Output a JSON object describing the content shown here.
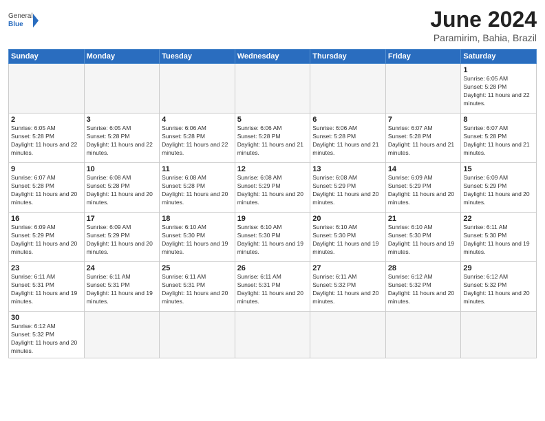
{
  "header": {
    "logo_general": "General",
    "logo_blue": "Blue",
    "month_title": "June 2024",
    "location": "Paramirim, Bahia, Brazil"
  },
  "days": [
    "Sunday",
    "Monday",
    "Tuesday",
    "Wednesday",
    "Thursday",
    "Friday",
    "Saturday"
  ],
  "cells": [
    {
      "date": "",
      "empty": true
    },
    {
      "date": "",
      "empty": true
    },
    {
      "date": "",
      "empty": true
    },
    {
      "date": "",
      "empty": true
    },
    {
      "date": "",
      "empty": true
    },
    {
      "date": "",
      "empty": true
    },
    {
      "date": "1",
      "sunrise": "6:05 AM",
      "sunset": "5:28 PM",
      "daylight": "11 hours and 22 minutes."
    },
    {
      "date": "2",
      "sunrise": "6:05 AM",
      "sunset": "5:28 PM",
      "daylight": "11 hours and 22 minutes."
    },
    {
      "date": "3",
      "sunrise": "6:05 AM",
      "sunset": "5:28 PM",
      "daylight": "11 hours and 22 minutes."
    },
    {
      "date": "4",
      "sunrise": "6:06 AM",
      "sunset": "5:28 PM",
      "daylight": "11 hours and 22 minutes."
    },
    {
      "date": "5",
      "sunrise": "6:06 AM",
      "sunset": "5:28 PM",
      "daylight": "11 hours and 21 minutes."
    },
    {
      "date": "6",
      "sunrise": "6:06 AM",
      "sunset": "5:28 PM",
      "daylight": "11 hours and 21 minutes."
    },
    {
      "date": "7",
      "sunrise": "6:07 AM",
      "sunset": "5:28 PM",
      "daylight": "11 hours and 21 minutes."
    },
    {
      "date": "8",
      "sunrise": "6:07 AM",
      "sunset": "5:28 PM",
      "daylight": "11 hours and 21 minutes."
    },
    {
      "date": "9",
      "sunrise": "6:07 AM",
      "sunset": "5:28 PM",
      "daylight": "11 hours and 20 minutes."
    },
    {
      "date": "10",
      "sunrise": "6:08 AM",
      "sunset": "5:28 PM",
      "daylight": "11 hours and 20 minutes."
    },
    {
      "date": "11",
      "sunrise": "6:08 AM",
      "sunset": "5:28 PM",
      "daylight": "11 hours and 20 minutes."
    },
    {
      "date": "12",
      "sunrise": "6:08 AM",
      "sunset": "5:29 PM",
      "daylight": "11 hours and 20 minutes."
    },
    {
      "date": "13",
      "sunrise": "6:08 AM",
      "sunset": "5:29 PM",
      "daylight": "11 hours and 20 minutes."
    },
    {
      "date": "14",
      "sunrise": "6:09 AM",
      "sunset": "5:29 PM",
      "daylight": "11 hours and 20 minutes."
    },
    {
      "date": "15",
      "sunrise": "6:09 AM",
      "sunset": "5:29 PM",
      "daylight": "11 hours and 20 minutes."
    },
    {
      "date": "16",
      "sunrise": "6:09 AM",
      "sunset": "5:29 PM",
      "daylight": "11 hours and 20 minutes."
    },
    {
      "date": "17",
      "sunrise": "6:09 AM",
      "sunset": "5:29 PM",
      "daylight": "11 hours and 20 minutes."
    },
    {
      "date": "18",
      "sunrise": "6:10 AM",
      "sunset": "5:30 PM",
      "daylight": "11 hours and 19 minutes."
    },
    {
      "date": "19",
      "sunrise": "6:10 AM",
      "sunset": "5:30 PM",
      "daylight": "11 hours and 19 minutes."
    },
    {
      "date": "20",
      "sunrise": "6:10 AM",
      "sunset": "5:30 PM",
      "daylight": "11 hours and 19 minutes."
    },
    {
      "date": "21",
      "sunrise": "6:10 AM",
      "sunset": "5:30 PM",
      "daylight": "11 hours and 19 minutes."
    },
    {
      "date": "22",
      "sunrise": "6:11 AM",
      "sunset": "5:30 PM",
      "daylight": "11 hours and 19 minutes."
    },
    {
      "date": "23",
      "sunrise": "6:11 AM",
      "sunset": "5:31 PM",
      "daylight": "11 hours and 19 minutes."
    },
    {
      "date": "24",
      "sunrise": "6:11 AM",
      "sunset": "5:31 PM",
      "daylight": "11 hours and 19 minutes."
    },
    {
      "date": "25",
      "sunrise": "6:11 AM",
      "sunset": "5:31 PM",
      "daylight": "11 hours and 20 minutes."
    },
    {
      "date": "26",
      "sunrise": "6:11 AM",
      "sunset": "5:31 PM",
      "daylight": "11 hours and 20 minutes."
    },
    {
      "date": "27",
      "sunrise": "6:11 AM",
      "sunset": "5:32 PM",
      "daylight": "11 hours and 20 minutes."
    },
    {
      "date": "28",
      "sunrise": "6:12 AM",
      "sunset": "5:32 PM",
      "daylight": "11 hours and 20 minutes."
    },
    {
      "date": "29",
      "sunrise": "6:12 AM",
      "sunset": "5:32 PM",
      "daylight": "11 hours and 20 minutes."
    },
    {
      "date": "30",
      "sunrise": "6:12 AM",
      "sunset": "5:32 PM",
      "daylight": "11 hours and 20 minutes."
    },
    {
      "date": "",
      "empty": true
    },
    {
      "date": "",
      "empty": true
    },
    {
      "date": "",
      "empty": true
    },
    {
      "date": "",
      "empty": true
    },
    {
      "date": "",
      "empty": true
    },
    {
      "date": "",
      "empty": true
    }
  ]
}
